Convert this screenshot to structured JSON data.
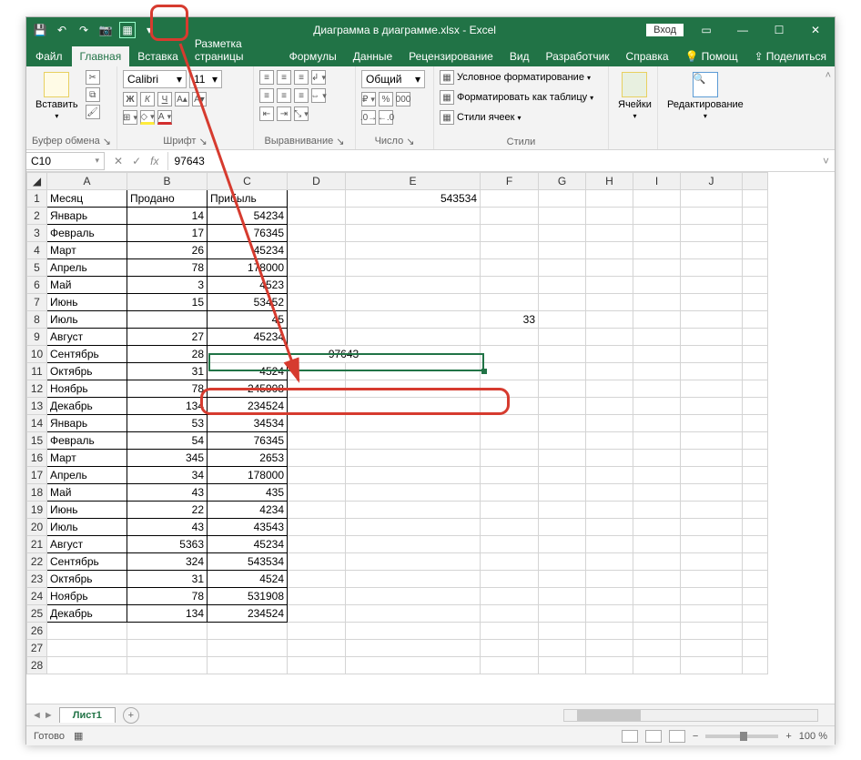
{
  "title": "Диаграмма в диаграмме.xlsx - Excel",
  "login_button": "Вход",
  "file_menu": "Файл",
  "tabs": [
    "Главная",
    "Вставка",
    "Разметка страницы",
    "Формулы",
    "Данные",
    "Рецензирование",
    "Вид",
    "Разработчик",
    "Справка"
  ],
  "tell_me": "Помощ",
  "share": "Поделиться",
  "ribbon": {
    "clipboard": {
      "paste": "Вставить",
      "label": "Буфер обмена"
    },
    "font": {
      "name": "Calibri",
      "size": "11",
      "bold": "Ж",
      "italic": "К",
      "underline": "Ч",
      "label": "Шрифт"
    },
    "align": {
      "label": "Выравнивание"
    },
    "number": {
      "format": "Общий",
      "label": "Число"
    },
    "styles": {
      "cond": "Условное форматирование",
      "table": "Форматировать как таблицу",
      "cell": "Стили ячеек",
      "label": "Стили"
    },
    "cells": {
      "label": "Ячейки"
    },
    "editing": {
      "label": "Редактирование"
    }
  },
  "namebox": "C10",
  "formula": "97643",
  "columns": [
    "A",
    "B",
    "C",
    "D",
    "E",
    "F",
    "G",
    "H",
    "I",
    "J"
  ],
  "headers": {
    "A": "Месяц",
    "B": "Продано",
    "C": "Прибыль"
  },
  "E1": "543534",
  "F8": "33",
  "rows": [
    {
      "n": 1
    },
    {
      "n": 2,
      "A": "Январь",
      "B": "14",
      "C": "54234"
    },
    {
      "n": 3,
      "A": "Февраль",
      "B": "17",
      "C": "76345"
    },
    {
      "n": 4,
      "A": "Март",
      "B": "26",
      "C": "45234"
    },
    {
      "n": 5,
      "A": "Апрель",
      "B": "78",
      "C": "178000"
    },
    {
      "n": 6,
      "A": "Май",
      "B": "3",
      "C": "4523"
    },
    {
      "n": 7,
      "A": "Июнь",
      "B": "15",
      "C": "53452"
    },
    {
      "n": 8,
      "A": "Июль",
      "B": "",
      "C": "45"
    },
    {
      "n": 9,
      "A": "Август",
      "B": "27",
      "C": "45234"
    },
    {
      "n": 10,
      "A": "Сентябрь",
      "B": "28",
      "merged": "97643"
    },
    {
      "n": 11,
      "A": "Октябрь",
      "B": "31",
      "C": "4524"
    },
    {
      "n": 12,
      "A": "Ноябрь",
      "B": "78",
      "C": "245908"
    },
    {
      "n": 13,
      "A": "Декабрь",
      "B": "134",
      "C": "234524"
    },
    {
      "n": 14,
      "A": "Январь",
      "B": "53",
      "C": "34534"
    },
    {
      "n": 15,
      "A": "Февраль",
      "B": "54",
      "C": "76345"
    },
    {
      "n": 16,
      "A": "Март",
      "B": "345",
      "C": "2653"
    },
    {
      "n": 17,
      "A": "Апрель",
      "B": "34",
      "C": "178000"
    },
    {
      "n": 18,
      "A": "Май",
      "B": "43",
      "C": "435"
    },
    {
      "n": 19,
      "A": "Июнь",
      "B": "22",
      "C": "4234"
    },
    {
      "n": 20,
      "A": "Июль",
      "B": "43",
      "C": "43543"
    },
    {
      "n": 21,
      "A": "Август",
      "B": "5363",
      "C": "45234"
    },
    {
      "n": 22,
      "A": "Сентябрь",
      "B": "324",
      "C": "543534"
    },
    {
      "n": 23,
      "A": "Октябрь",
      "B": "31",
      "C": "4524"
    },
    {
      "n": 24,
      "A": "Ноябрь",
      "B": "78",
      "C": "531908"
    },
    {
      "n": 25,
      "A": "Декабрь",
      "B": "134",
      "C": "234524"
    }
  ],
  "sheet_name": "Лист1",
  "status": "Готово",
  "zoom": "100 %"
}
